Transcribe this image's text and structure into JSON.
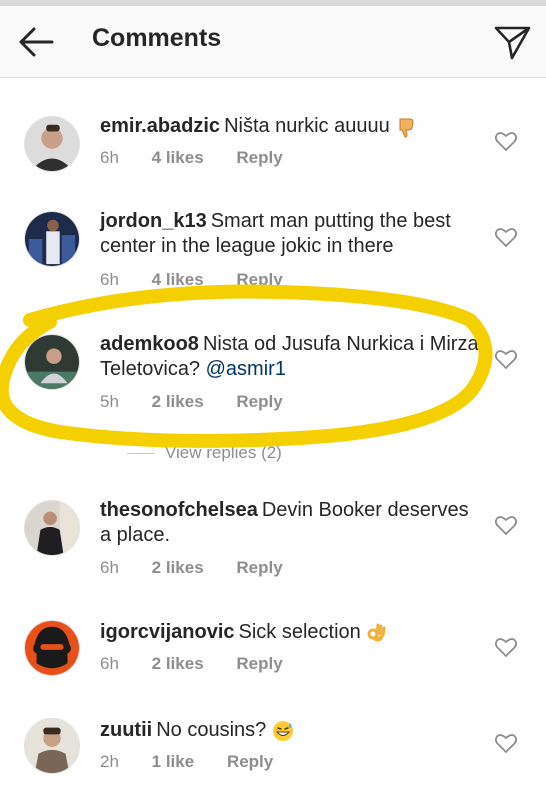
{
  "header": {
    "title": "Comments",
    "back_icon": "arrow-left-icon",
    "send_icon": "paper-plane-icon"
  },
  "comments": [
    {
      "username": "emir.abadzic",
      "text": "Ništa nurkic auuuu",
      "emoji": "thumbs-down-emoji",
      "time": "6h",
      "likes": "4 likes",
      "reply": "Reply"
    },
    {
      "username": "jordon_k13",
      "text": "Smart man putting the best center in the league jokic in there",
      "time": "6h",
      "likes": "4 likes",
      "reply": "Reply"
    },
    {
      "username": "ademkoo8",
      "text": "Nista od Jusufa Nurkica i Mirza Teletovica?",
      "mention": "@asmir1",
      "time": "5h",
      "likes": "2 likes",
      "reply": "Reply",
      "view_replies": "View replies (2)"
    },
    {
      "username": "thesonofchelsea",
      "text": "Devin Booker deserves a place.",
      "time": "6h",
      "likes": "2 likes",
      "reply": "Reply"
    },
    {
      "username": "igorcvijanovic",
      "text": "Sick selection",
      "emoji": "ok-hand-emoji",
      "time": "6h",
      "likes": "2 likes",
      "reply": "Reply"
    },
    {
      "username": "zuutii",
      "text": "No cousins?",
      "emoji": "grinning-sweat-emoji",
      "time": "2h",
      "likes": "1 like",
      "reply": "Reply"
    }
  ],
  "colors": {
    "highlight": "#f5d000",
    "meta_gray": "#8e8e8e",
    "mention": "#003569"
  }
}
